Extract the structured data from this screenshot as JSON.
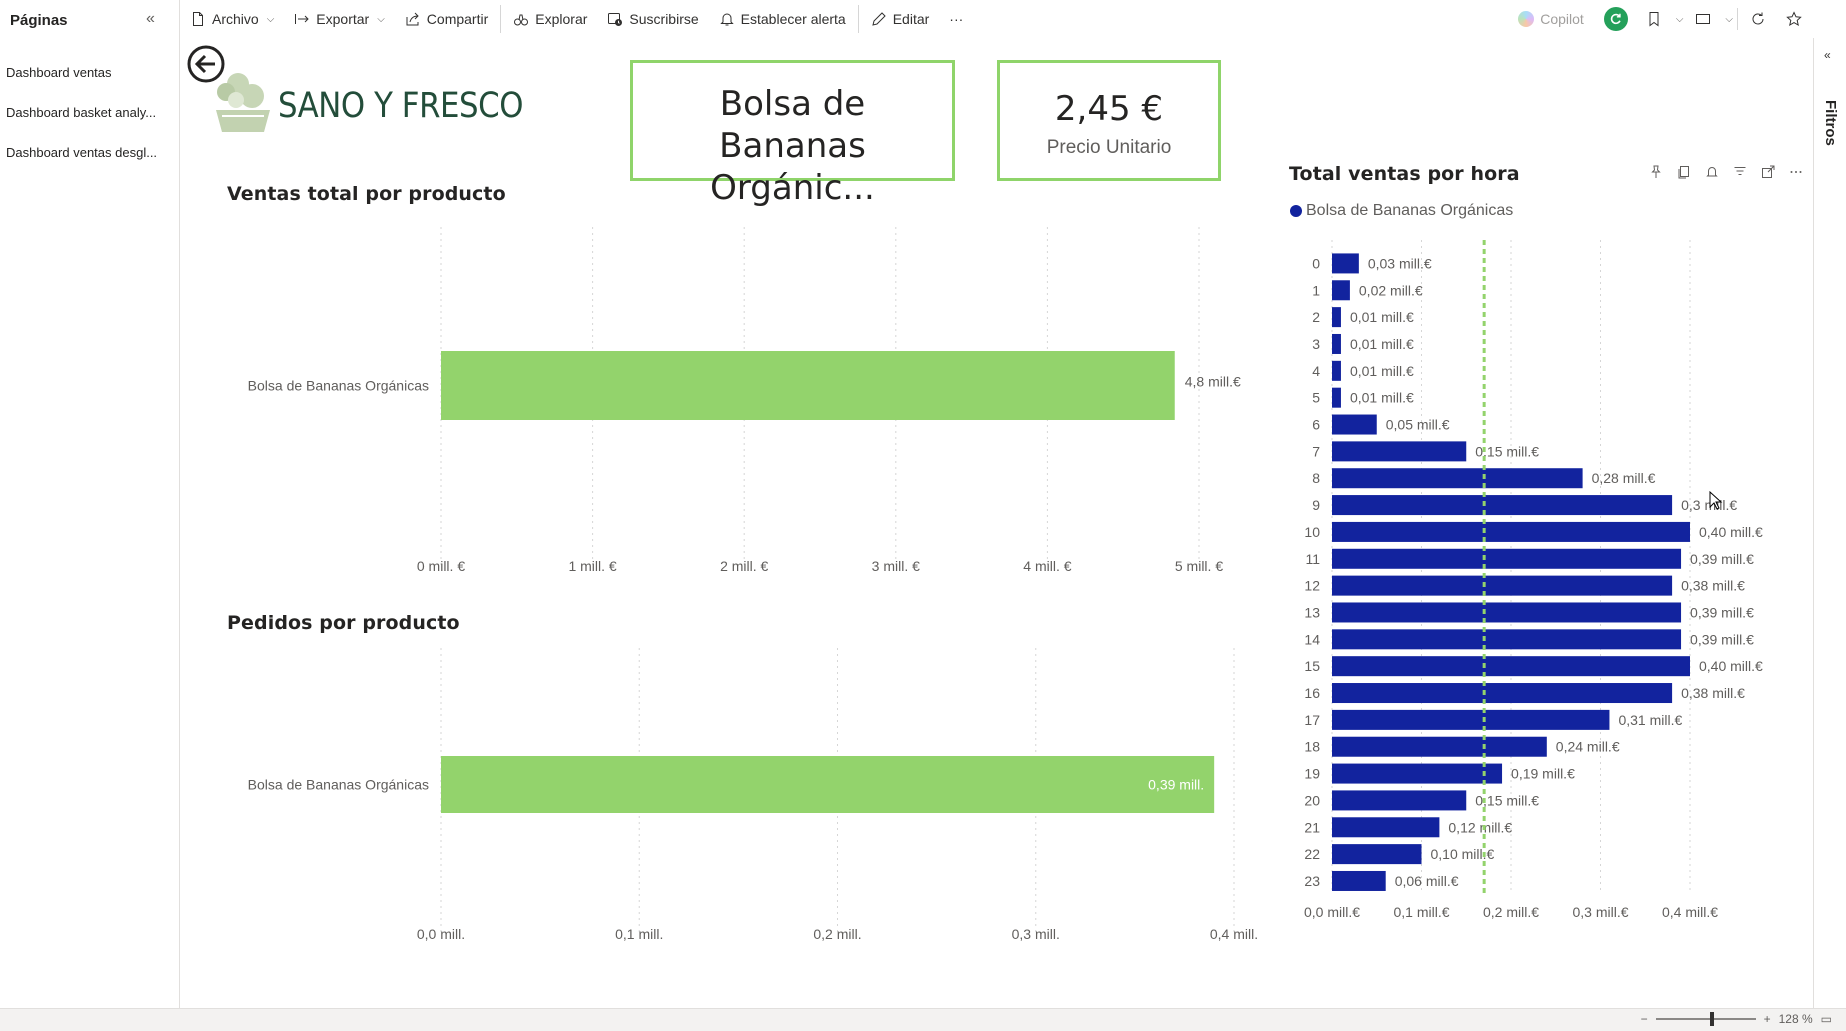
{
  "toolbar": {
    "file": "Archivo",
    "export": "Exportar",
    "share": "Compartir",
    "explore": "Explorar",
    "subscribe": "Suscribirse",
    "alert": "Establecer alerta",
    "edit": "Editar",
    "more": "···",
    "copilot": "Copilot"
  },
  "pages": {
    "title": "Páginas",
    "items": [
      "Dashboard ventas",
      "Dashboard basket analy...",
      "Dashboard ventas desgl..."
    ]
  },
  "logo": {
    "text": "SANO Y FRESCO"
  },
  "cards": {
    "product": {
      "line1": "Bolsa de",
      "line2": "Bananas Orgánic..."
    },
    "price": {
      "value": "2,45 €",
      "label": "Precio Unitario"
    }
  },
  "filters": {
    "label": "Filtros"
  },
  "status": {
    "zoom": "128 %"
  },
  "colors": {
    "accent_green": "#8fd46a",
    "bar_green": "#93d36c",
    "bar_navy": "#12239e",
    "avg_line": "#93d36c"
  },
  "chart_data": [
    {
      "type": "bar",
      "orientation": "horizontal",
      "title": "Ventas total por producto",
      "categories": [
        "Bolsa de Bananas Orgánicas"
      ],
      "values": [
        4.84
      ],
      "data_labels": [
        "4,8 mill.€"
      ],
      "xticks": [
        "0 mill. €",
        "1 mill. €",
        "2 mill. €",
        "3 mill. €",
        "4 mill. €",
        "5 mill. €"
      ],
      "xlim": [
        0,
        5
      ],
      "grid": true
    },
    {
      "type": "bar",
      "orientation": "horizontal",
      "title": "Pedidos por producto",
      "categories": [
        "Bolsa de Bananas Orgánicas"
      ],
      "values": [
        0.39
      ],
      "data_labels": [
        "0,39 mill."
      ],
      "xticks": [
        "0,0 mill.",
        "0,1 mill.",
        "0,2 mill.",
        "0,3 mill.",
        "0,4 mill."
      ],
      "xlim": [
        0,
        0.4
      ],
      "grid": true
    },
    {
      "type": "bar",
      "orientation": "horizontal",
      "title": "Total ventas por hora",
      "legend": [
        "Bolsa de Bananas Orgánicas"
      ],
      "categories": [
        "0",
        "1",
        "2",
        "3",
        "4",
        "5",
        "6",
        "7",
        "8",
        "9",
        "10",
        "11",
        "12",
        "13",
        "14",
        "15",
        "16",
        "17",
        "18",
        "19",
        "20",
        "21",
        "22",
        "23"
      ],
      "values": [
        0.03,
        0.02,
        0.01,
        0.01,
        0.01,
        0.01,
        0.05,
        0.15,
        0.28,
        0.38,
        0.4,
        0.39,
        0.38,
        0.39,
        0.39,
        0.4,
        0.38,
        0.31,
        0.24,
        0.19,
        0.15,
        0.12,
        0.1,
        0.06
      ],
      "data_labels": [
        "0,03 mill.€",
        "0,02 mill.€",
        "0,01 mill.€",
        "0,01 mill.€",
        "0,01 mill.€",
        "0,01 mill.€",
        "0,05 mill.€",
        "0,15 mill.€",
        "0,28 mill.€",
        "0,3 mill.€",
        "0,40 mill.€",
        "0,39 mill.€",
        "0,38 mill.€",
        "0,39 mill.€",
        "0,39 mill.€",
        "0,40 mill.€",
        "0,38 mill.€",
        "0,31 mill.€",
        "0,24 mill.€",
        "0,19 mill.€",
        "0,15 mill.€",
        "0,12 mill.€",
        "0,10 mill.€",
        "0,06 mill.€"
      ],
      "xticks": [
        "0,0 mill.€",
        "0,1 mill.€",
        "0,2 mill.€",
        "0,3 mill.€",
        "0,4 mill.€"
      ],
      "xlim": [
        0,
        0.4
      ],
      "average_line": 0.17,
      "grid": true
    }
  ]
}
